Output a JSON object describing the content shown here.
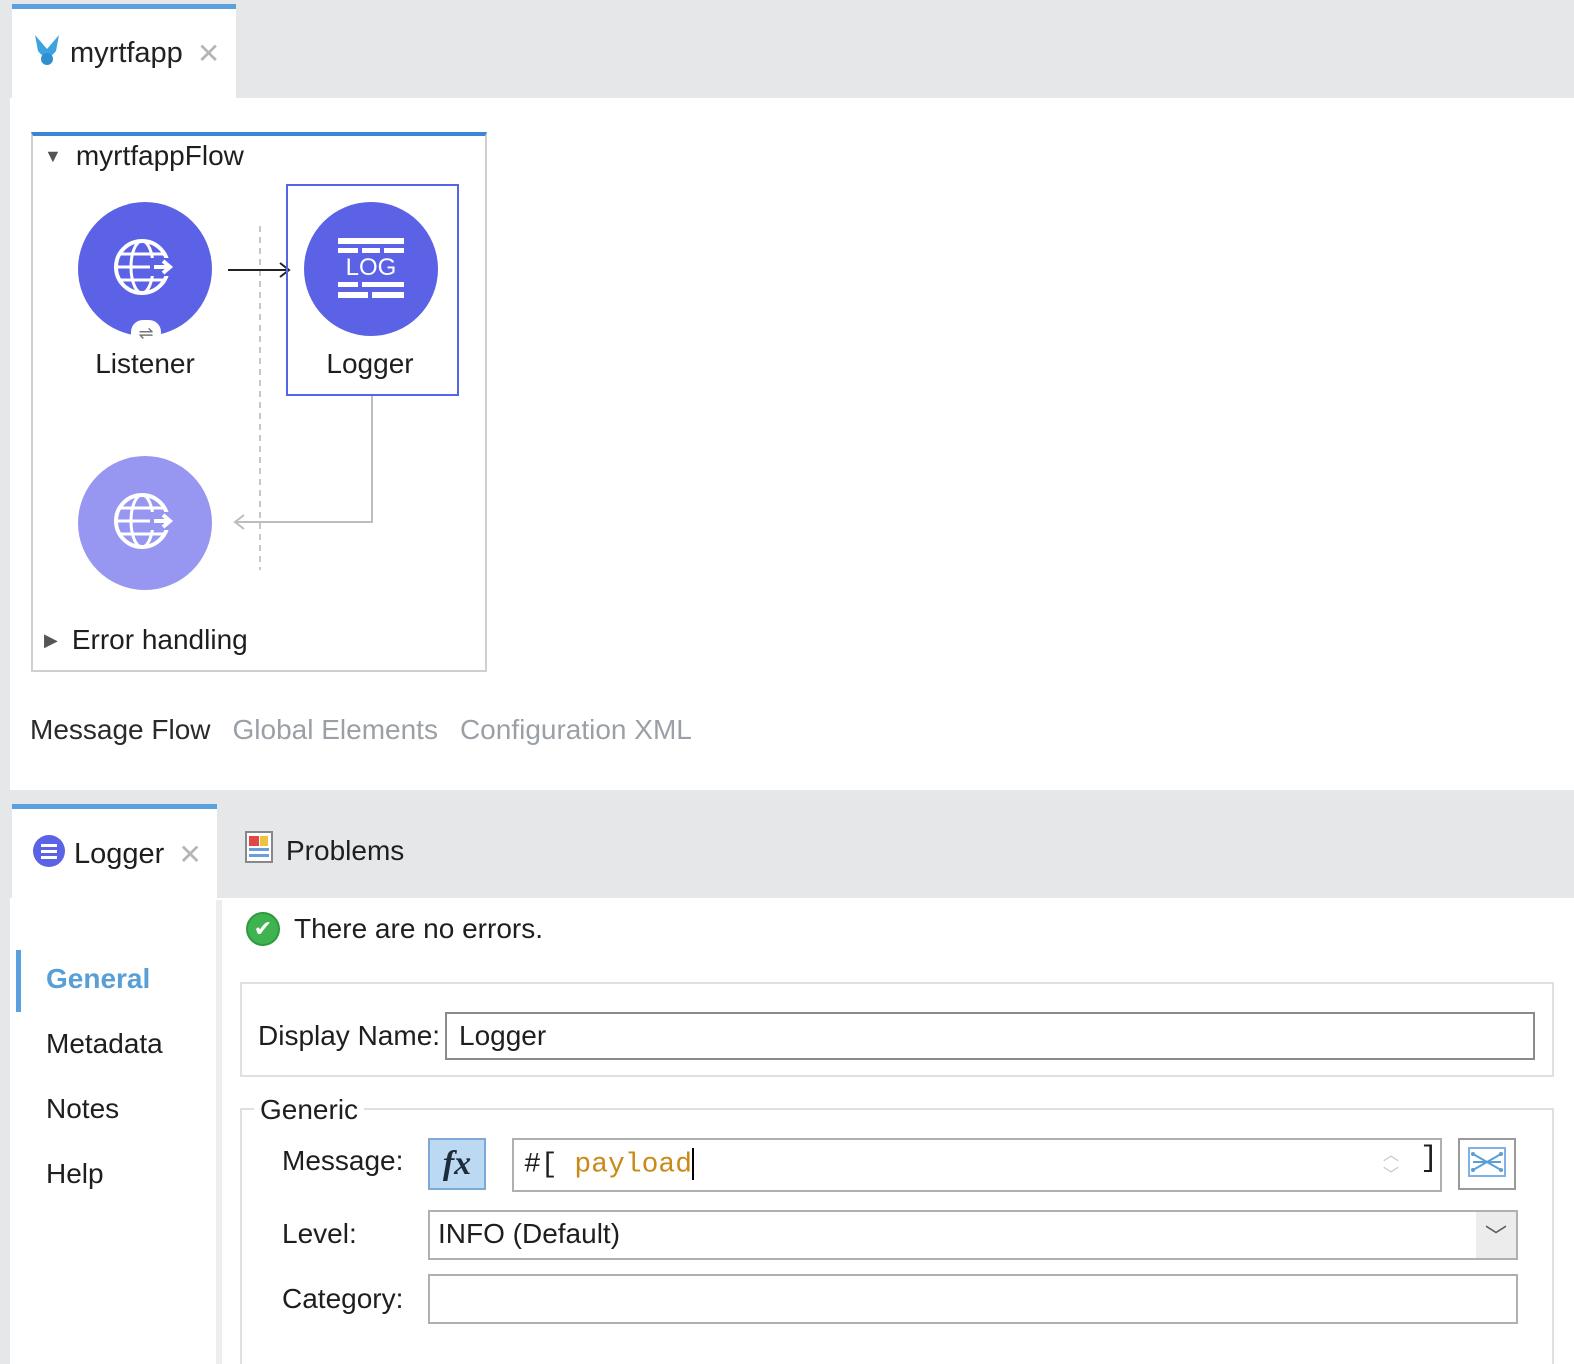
{
  "editor": {
    "tab_title": "myrtfapp",
    "flow_name": "myrtfappFlow",
    "nodes": {
      "listener_label": "Listener",
      "logger_label": "Logger",
      "logger_icon_text": "LOG"
    },
    "error_handling_label": "Error handling",
    "canvas_tabs": [
      "Message Flow",
      "Global Elements",
      "Configuration XML"
    ],
    "active_canvas_tab": "Message Flow"
  },
  "panel": {
    "tabs": {
      "logger": "Logger",
      "problems": "Problems"
    },
    "status_message": "There are no errors.",
    "nav_items": [
      "General",
      "Metadata",
      "Notes",
      "Help"
    ],
    "active_nav": "General",
    "form": {
      "display_name_label": "Display Name:",
      "display_name_value": "Logger",
      "generic_legend": "Generic",
      "message_label": "Message:",
      "fx_label": "fx",
      "message_prefix": "#[",
      "message_value": "payload",
      "message_suffix": "]",
      "level_label": "Level:",
      "level_value": "INFO (Default)",
      "category_label": "Category:",
      "category_value": ""
    }
  },
  "colors": {
    "node_primary": "#5b62e6",
    "node_secondary": "#9797f2",
    "accent_blue": "#5aa0dc",
    "success_green": "#3fb34f",
    "payload_text": "#c98a18"
  }
}
